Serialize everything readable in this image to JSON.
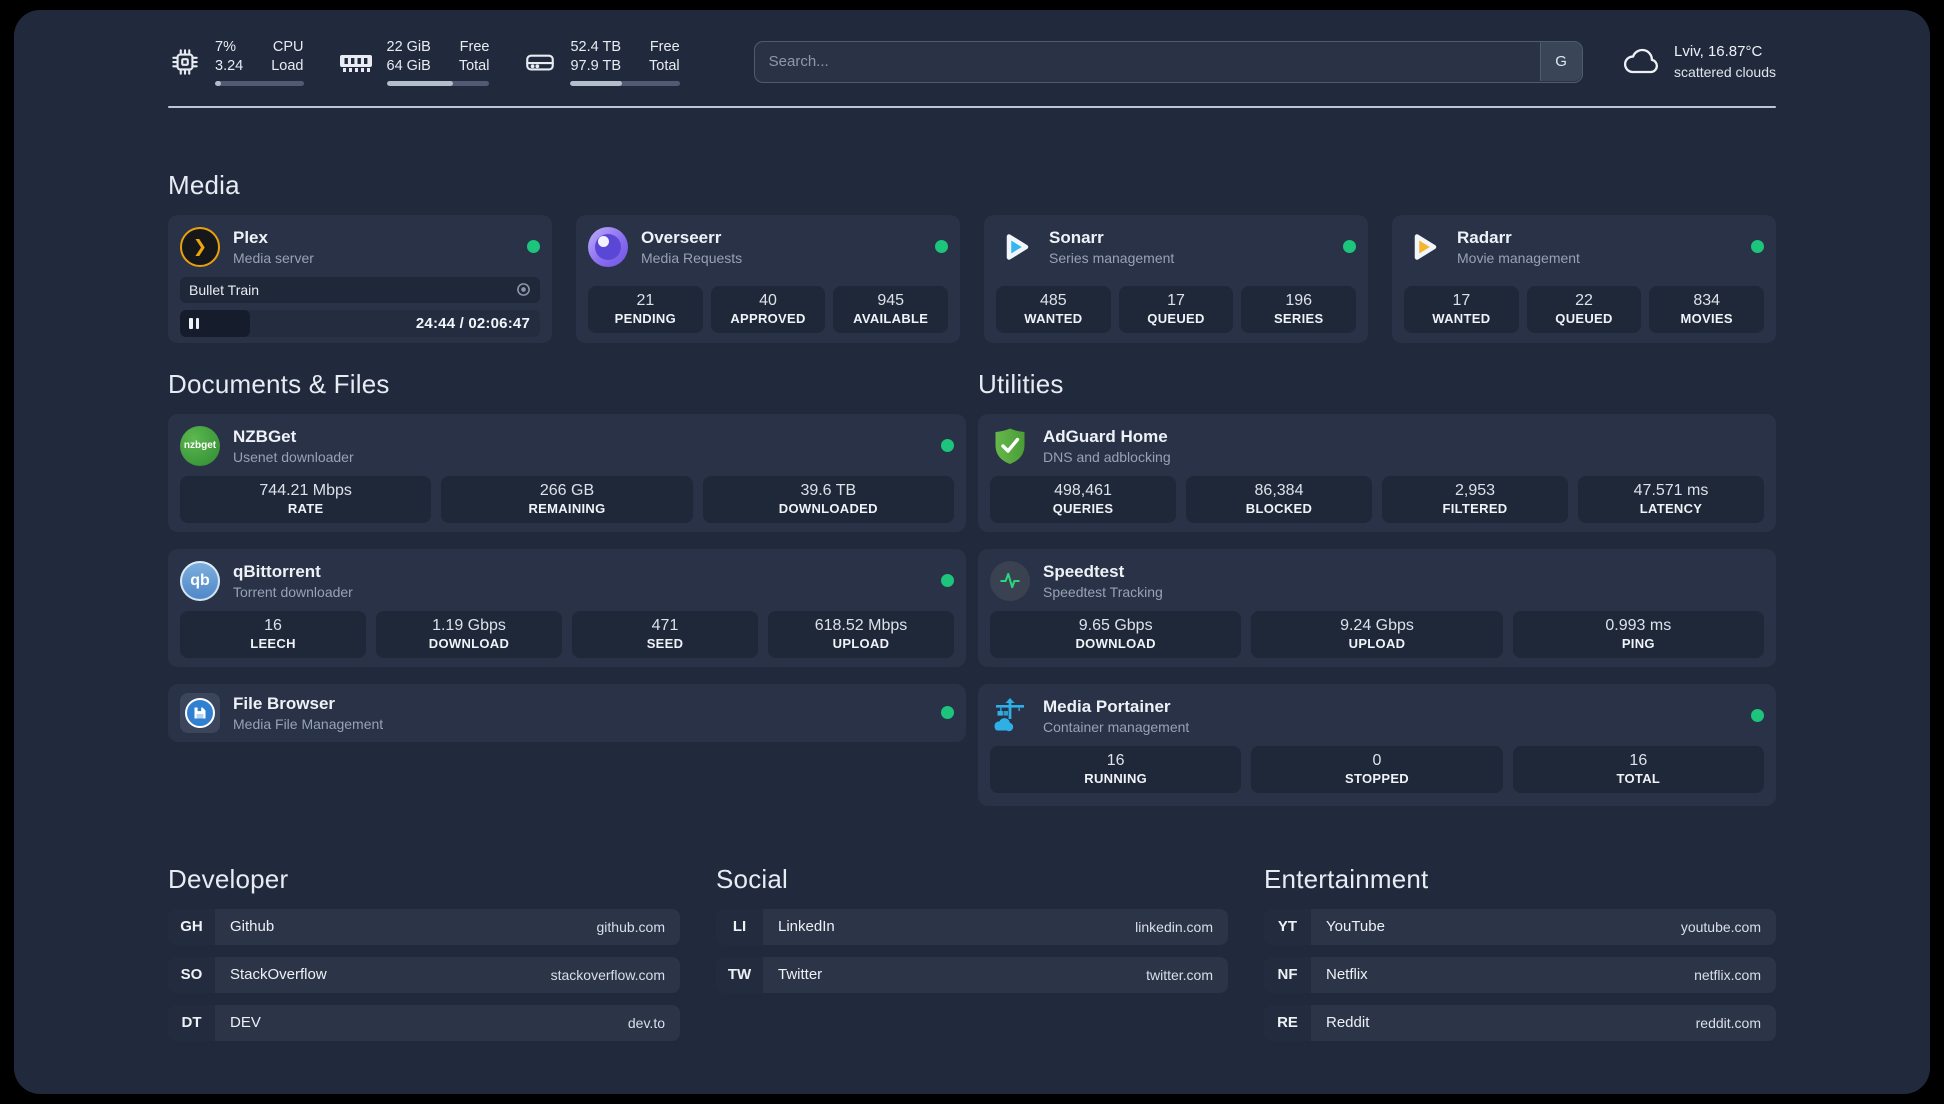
{
  "topbar": {
    "cpu": {
      "values": [
        "7%",
        "3.24"
      ],
      "labels": [
        "CPU",
        "Load"
      ],
      "progress_pct": 7
    },
    "ram": {
      "values": [
        "22 GiB",
        "64 GiB"
      ],
      "labels": [
        "Free",
        "Total"
      ],
      "progress_pct": 65
    },
    "disk": {
      "values": [
        "52.4 TB",
        "97.9 TB"
      ],
      "labels": [
        "Free",
        "Total"
      ],
      "progress_pct": 47
    },
    "search": {
      "placeholder": "Search...",
      "button_label": "G"
    },
    "weather": {
      "location_temp": "Lviv, 16.87°C",
      "condition": "scattered clouds"
    }
  },
  "media": {
    "title": "Media",
    "plex": {
      "name": "Plex",
      "description": "Media server",
      "logo_text": "❯",
      "online": true,
      "now_playing": {
        "title": "Bullet Train",
        "time": "24:44 / 02:06:47",
        "progress_pct": 19.5
      }
    },
    "overseerr": {
      "name": "Overseerr",
      "description": "Media Requests",
      "online": true,
      "stats": [
        {
          "value": "21",
          "label": "PENDING"
        },
        {
          "value": "40",
          "label": "APPROVED"
        },
        {
          "value": "945",
          "label": "AVAILABLE"
        }
      ]
    },
    "sonarr": {
      "name": "Sonarr",
      "description": "Series management",
      "online": true,
      "stats": [
        {
          "value": "485",
          "label": "WANTED"
        },
        {
          "value": "17",
          "label": "QUEUED"
        },
        {
          "value": "196",
          "label": "SERIES"
        }
      ]
    },
    "radarr": {
      "name": "Radarr",
      "description": "Movie management",
      "online": true,
      "stats": [
        {
          "value": "17",
          "label": "WANTED"
        },
        {
          "value": "22",
          "label": "QUEUED"
        },
        {
          "value": "834",
          "label": "MOVIES"
        }
      ]
    }
  },
  "documents": {
    "title": "Documents & Files",
    "nzbget": {
      "name": "NZBGet",
      "description": "Usenet downloader",
      "logo_text": "nzbget",
      "online": true,
      "stats": [
        {
          "value": "744.21 Mbps",
          "label": "RATE"
        },
        {
          "value": "266 GB",
          "label": "REMAINING"
        },
        {
          "value": "39.6 TB",
          "label": "DOWNLOADED"
        }
      ]
    },
    "qbittorrent": {
      "name": "qBittorrent",
      "description": "Torrent downloader",
      "logo_text": "qb",
      "online": true,
      "stats": [
        {
          "value": "16",
          "label": "LEECH"
        },
        {
          "value": "1.19 Gbps",
          "label": "DOWNLOAD"
        },
        {
          "value": "471",
          "label": "SEED"
        },
        {
          "value": "618.52 Mbps",
          "label": "UPLOAD"
        }
      ]
    },
    "filebrowser": {
      "name": "File Browser",
      "description": "Media File Management",
      "online": true
    }
  },
  "utilities": {
    "title": "Utilities",
    "adguard": {
      "name": "AdGuard Home",
      "description": "DNS and adblocking",
      "stats": [
        {
          "value": "498,461",
          "label": "QUERIES"
        },
        {
          "value": "86,384",
          "label": "BLOCKED"
        },
        {
          "value": "2,953",
          "label": "FILTERED"
        },
        {
          "value": "47.571 ms",
          "label": "LATENCY"
        }
      ]
    },
    "speedtest": {
      "name": "Speedtest",
      "description": "Speedtest Tracking",
      "stats": [
        {
          "value": "9.65 Gbps",
          "label": "DOWNLOAD"
        },
        {
          "value": "9.24 Gbps",
          "label": "UPLOAD"
        },
        {
          "value": "0.993 ms",
          "label": "PING"
        }
      ]
    },
    "portainer": {
      "name": "Media Portainer",
      "description": "Container management",
      "online": true,
      "stats": [
        {
          "value": "16",
          "label": "RUNNING"
        },
        {
          "value": "0",
          "label": "STOPPED"
        },
        {
          "value": "16",
          "label": "TOTAL"
        }
      ]
    }
  },
  "links": {
    "developer": {
      "title": "Developer",
      "items": [
        {
          "abbr": "GH",
          "name": "Github",
          "url": "github.com"
        },
        {
          "abbr": "SO",
          "name": "StackOverflow",
          "url": "stackoverflow.com"
        },
        {
          "abbr": "DT",
          "name": "DEV",
          "url": "dev.to"
        }
      ]
    },
    "social": {
      "title": "Social",
      "items": [
        {
          "abbr": "LI",
          "name": "LinkedIn",
          "url": "linkedin.com"
        },
        {
          "abbr": "TW",
          "name": "Twitter",
          "url": "twitter.com"
        }
      ]
    },
    "entertainment": {
      "title": "Entertainment",
      "items": [
        {
          "abbr": "YT",
          "name": "YouTube",
          "url": "youtube.com"
        },
        {
          "abbr": "NF",
          "name": "Netflix",
          "url": "netflix.com"
        },
        {
          "abbr": "RE",
          "name": "Reddit",
          "url": "reddit.com"
        }
      ]
    }
  },
  "colors": {
    "accent_green": "#1dc47c",
    "background": "#212a3d",
    "card": "#293247"
  }
}
